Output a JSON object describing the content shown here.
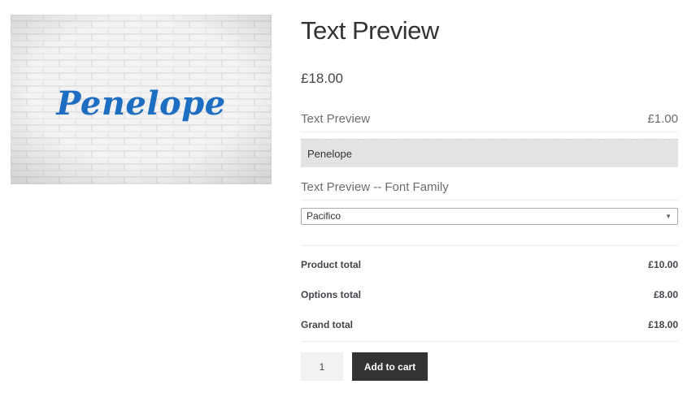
{
  "product": {
    "title": "Text Preview",
    "price": "£18.00",
    "image_text": "Penelope"
  },
  "options": {
    "text_preview_label": "Text Preview",
    "text_preview_price": "£1.00",
    "text_preview_value": "Penelope",
    "font_family_label": "Text Preview -- Font Family",
    "font_family_selected": "Pacifico"
  },
  "totals": {
    "product_total_label": "Product total",
    "product_total_value": "£10.00",
    "options_total_label": "Options total",
    "options_total_value": "£8.00",
    "grand_total_label": "Grand total",
    "grand_total_value": "£18.00"
  },
  "cart": {
    "quantity": "1",
    "add_to_cart_label": "Add to cart"
  },
  "icons": {
    "select_arrow": "chevron-down-icon"
  },
  "colors": {
    "preview_text": "#1d6ec2",
    "button_bg": "#333333",
    "input_bg": "#e3e3e3"
  }
}
